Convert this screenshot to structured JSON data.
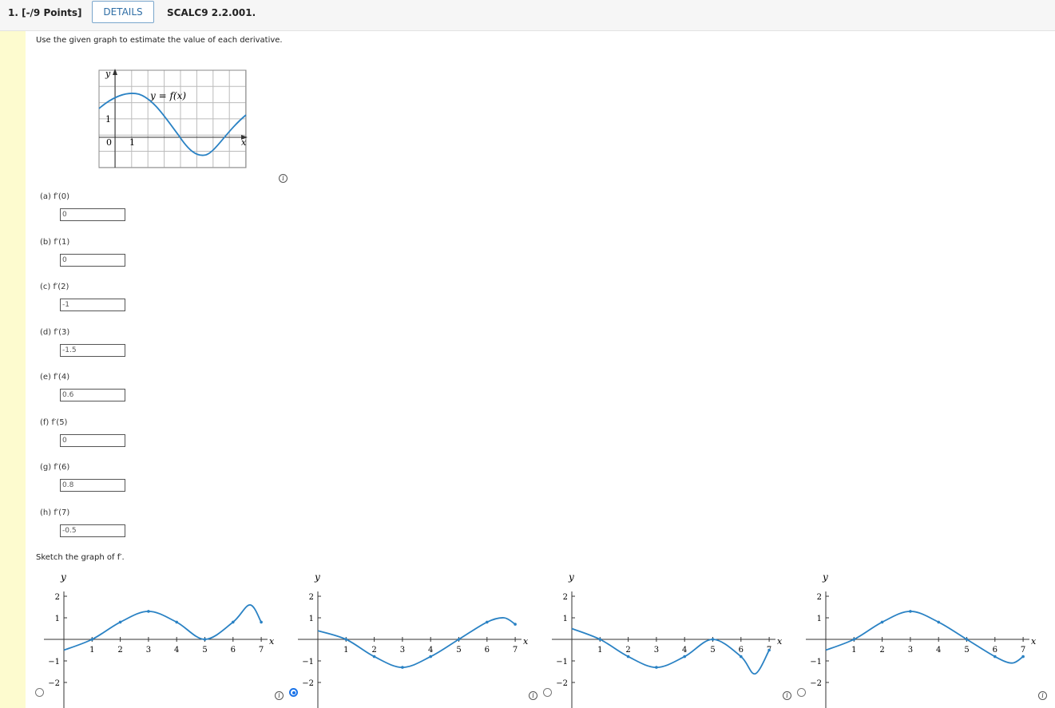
{
  "header": {
    "points": "1. [-/9 Points]",
    "details": "DETAILS",
    "code": "SCALC9 2.2.001."
  },
  "instruction": "Use the given graph to estimate the value of each derivative.",
  "graph": {
    "y_axis": "y",
    "x_axis": "x",
    "label": "y = f(x)",
    "tick_y": "1",
    "tick_origin": "0",
    "tick_x": "1"
  },
  "questions": [
    {
      "label": "(a)  f′(0)",
      "value": "0"
    },
    {
      "label": "(b)  f′(1)",
      "value": "0"
    },
    {
      "label": "(c)  f′(2)",
      "value": "-1"
    },
    {
      "label": "(d)  f′(3)",
      "value": "-1.5"
    },
    {
      "label": "(e)  f′(4)",
      "value": "0.6"
    },
    {
      "label": "(f)  f′(5)",
      "value": "0"
    },
    {
      "label": "(g)  f′(6)",
      "value": "0.8"
    },
    {
      "label": "(h)  f′(7)",
      "value": "-0.5"
    }
  ],
  "sketch_prompt": "Sketch the graph of f′.",
  "axis_text": {
    "y": "y",
    "x": "x",
    "y_ticks": [
      "2",
      "1",
      "−1",
      "−2"
    ],
    "x_ticks": [
      "1",
      "2",
      "3",
      "4",
      "5",
      "6",
      "7"
    ]
  },
  "options": [
    {
      "selected": false,
      "points": [
        [
          0,
          -0.5
        ],
        [
          1,
          0
        ],
        [
          2,
          0.8
        ],
        [
          3,
          1.3
        ],
        [
          4,
          0.8
        ],
        [
          5,
          0
        ],
        [
          6,
          0.8
        ],
        [
          6.6,
          1.6
        ],
        [
          7,
          0.8
        ]
      ]
    },
    {
      "selected": true,
      "points": [
        [
          0,
          0.4
        ],
        [
          1,
          0
        ],
        [
          2,
          -0.8
        ],
        [
          3,
          -1.3
        ],
        [
          4,
          -0.8
        ],
        [
          5,
          0
        ],
        [
          6,
          0.8
        ],
        [
          6.6,
          1.0
        ],
        [
          7,
          0.7
        ]
      ]
    },
    {
      "selected": false,
      "points": [
        [
          0,
          0.5
        ],
        [
          1,
          0
        ],
        [
          2,
          -0.8
        ],
        [
          3,
          -1.3
        ],
        [
          4,
          -0.8
        ],
        [
          5,
          0
        ],
        [
          6,
          -0.8
        ],
        [
          6.5,
          -1.6
        ],
        [
          7,
          -0.5
        ]
      ]
    },
    {
      "selected": false,
      "points": [
        [
          0,
          -0.5
        ],
        [
          1,
          0
        ],
        [
          2,
          0.8
        ],
        [
          3,
          1.3
        ],
        [
          4,
          0.8
        ],
        [
          5,
          0
        ],
        [
          6,
          -0.8
        ],
        [
          6.6,
          -1.1
        ],
        [
          7,
          -0.8
        ]
      ]
    }
  ],
  "colors": {
    "curve": "#2a82c4",
    "grid": "#bbbbbb",
    "accent": "#1a73e8"
  }
}
